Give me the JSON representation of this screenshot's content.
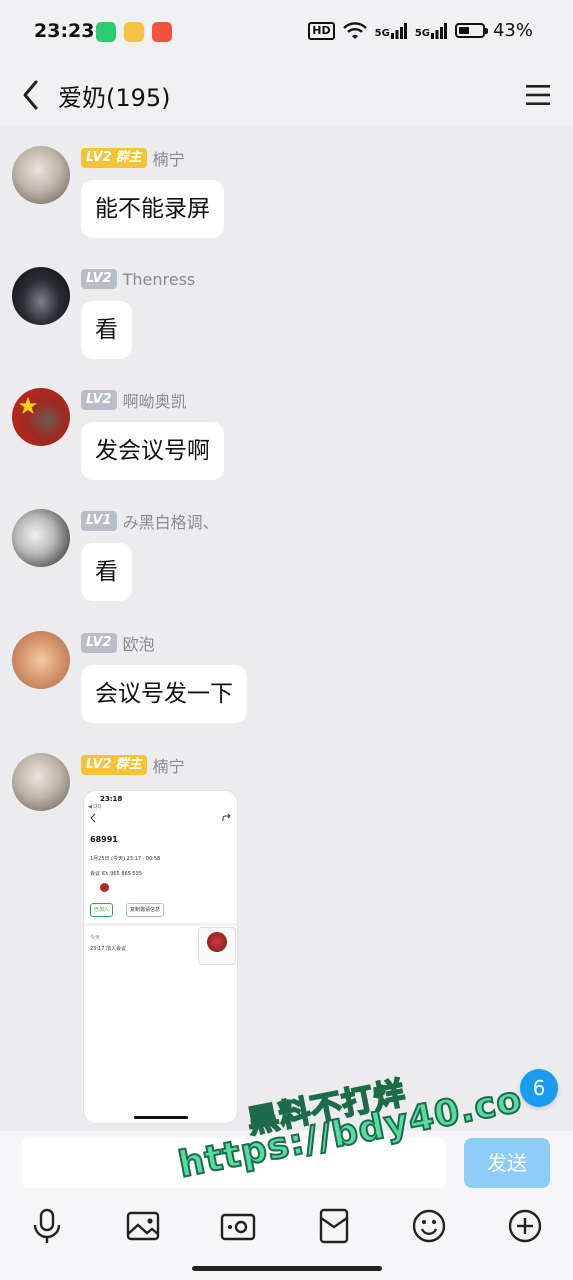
{
  "status_bar": {
    "time": "23:23",
    "hd_label": "HD",
    "network_1": "5G",
    "network_2": "5G",
    "battery": "43%"
  },
  "header": {
    "title": "爱奶(195)"
  },
  "badge_owner_lv": "LV2",
  "badge_owner_role": "群主",
  "messages": [
    {
      "level": "LV2",
      "role": "群主",
      "nick": "楠宁",
      "text": "能不能录屏"
    },
    {
      "level": "LV2",
      "nick": "Thenress",
      "text": "看"
    },
    {
      "level": "LV2",
      "nick": "啊呦奥凯",
      "text": "发会议号啊"
    },
    {
      "level": "LV1",
      "nick": "み黑白格调、",
      "text": "看"
    },
    {
      "level": "LV2",
      "nick": "欧泡",
      "text": "会议号发一下"
    },
    {
      "level": "LV2",
      "role": "群主",
      "nick": "楠宁",
      "image": true
    }
  ],
  "screenshot": {
    "time": "23:18",
    "qq": "◀ QQ",
    "meeting_title": "68991",
    "date_line": "1月25日 (今天) 23:17 · 00:58",
    "meeting_id_line": "会议 ID: 965 865 535",
    "joined_btn": "已加入",
    "copy_btn": "复制邀请信息",
    "today_label": "今天",
    "join_line": "23:17 加入会议"
  },
  "unread_count": "6",
  "input": {
    "placeholder": "",
    "send_label": "发送"
  },
  "toolbar_icons": [
    "mic-icon",
    "image-icon",
    "camera-icon",
    "red-packet-icon",
    "emoji-icon",
    "plus-icon"
  ],
  "watermark": {
    "line1": "黑料不打烊",
    "line2": "https://bdy40.co"
  },
  "colors": {
    "accent": "#1a9df0",
    "send_button": "#8dcdf8",
    "owner_badge": "#f7c336",
    "level_badge": "#b8bdc8",
    "watermark": "#55dca2"
  }
}
